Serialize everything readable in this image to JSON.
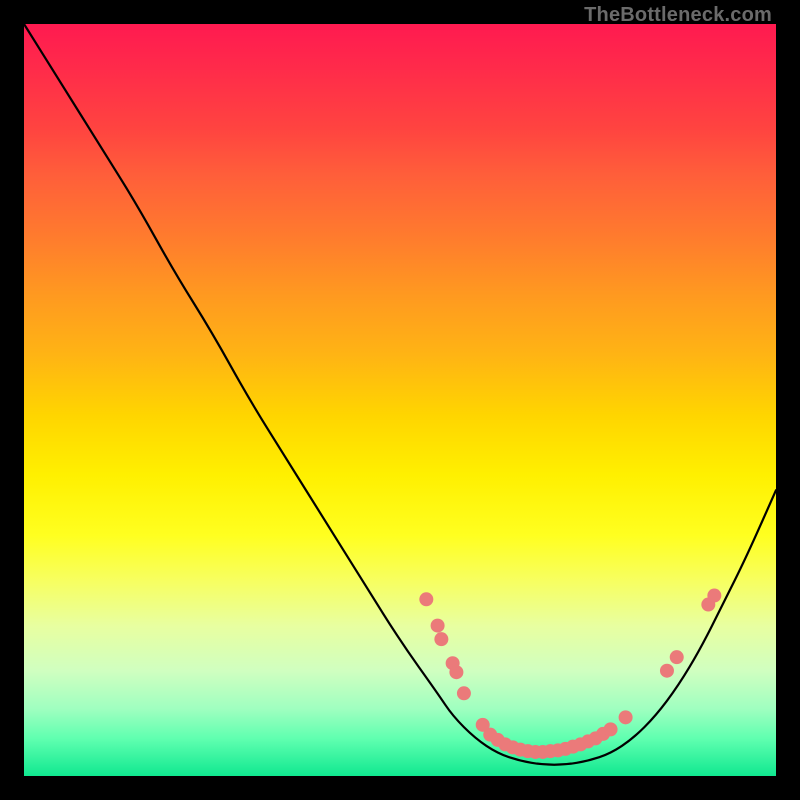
{
  "watermark": "TheBottleneck.com",
  "colors": {
    "dot": "#eb7a7a",
    "curve": "#000000"
  },
  "chart_data": {
    "type": "line",
    "title": "",
    "xlabel": "",
    "ylabel": "",
    "xlim": [
      0,
      100
    ],
    "ylim": [
      0,
      100
    ],
    "grid": false,
    "legend": false,
    "note": "No numeric axes shown in image; x and y are in percent of plot-area. y=0 is bottom (green), y=100 is top (red). Curve is the black bottleneck-shaped line; dots are the salmon-colored markers clustered along the valley and right slope.",
    "series": [
      {
        "name": "bottleneck-curve",
        "x": [
          0,
          5,
          10,
          15,
          20,
          25,
          30,
          35,
          40,
          45,
          50,
          55,
          57,
          60,
          63,
          66,
          69,
          72,
          75,
          78,
          81,
          84,
          87,
          90,
          93,
          96,
          100
        ],
        "y": [
          100,
          92,
          84,
          76,
          67,
          59,
          50,
          42,
          34,
          26,
          18,
          11,
          8,
          5,
          3,
          2,
          1.5,
          1.5,
          2,
          3,
          5,
          8,
          12,
          17,
          23,
          29,
          38
        ]
      }
    ],
    "dots": [
      {
        "x": 53.5,
        "y": 23.5
      },
      {
        "x": 55.0,
        "y": 20.0
      },
      {
        "x": 55.5,
        "y": 18.2
      },
      {
        "x": 57.0,
        "y": 15.0
      },
      {
        "x": 57.5,
        "y": 13.8
      },
      {
        "x": 58.5,
        "y": 11.0
      },
      {
        "x": 61.0,
        "y": 6.8
      },
      {
        "x": 62.0,
        "y": 5.5
      },
      {
        "x": 63.0,
        "y": 4.8
      },
      {
        "x": 64.0,
        "y": 4.2
      },
      {
        "x": 65.0,
        "y": 3.8
      },
      {
        "x": 66.0,
        "y": 3.5
      },
      {
        "x": 67.0,
        "y": 3.3
      },
      {
        "x": 68.0,
        "y": 3.2
      },
      {
        "x": 69.0,
        "y": 3.2
      },
      {
        "x": 70.0,
        "y": 3.3
      },
      {
        "x": 71.0,
        "y": 3.4
      },
      {
        "x": 72.0,
        "y": 3.6
      },
      {
        "x": 73.0,
        "y": 3.9
      },
      {
        "x": 74.0,
        "y": 4.2
      },
      {
        "x": 75.0,
        "y": 4.6
      },
      {
        "x": 76.0,
        "y": 5.0
      },
      {
        "x": 77.0,
        "y": 5.6
      },
      {
        "x": 78.0,
        "y": 6.2
      },
      {
        "x": 80.0,
        "y": 7.8
      },
      {
        "x": 85.5,
        "y": 14.0
      },
      {
        "x": 86.8,
        "y": 15.8
      },
      {
        "x": 91.0,
        "y": 22.8
      },
      {
        "x": 91.8,
        "y": 24.0
      }
    ]
  }
}
